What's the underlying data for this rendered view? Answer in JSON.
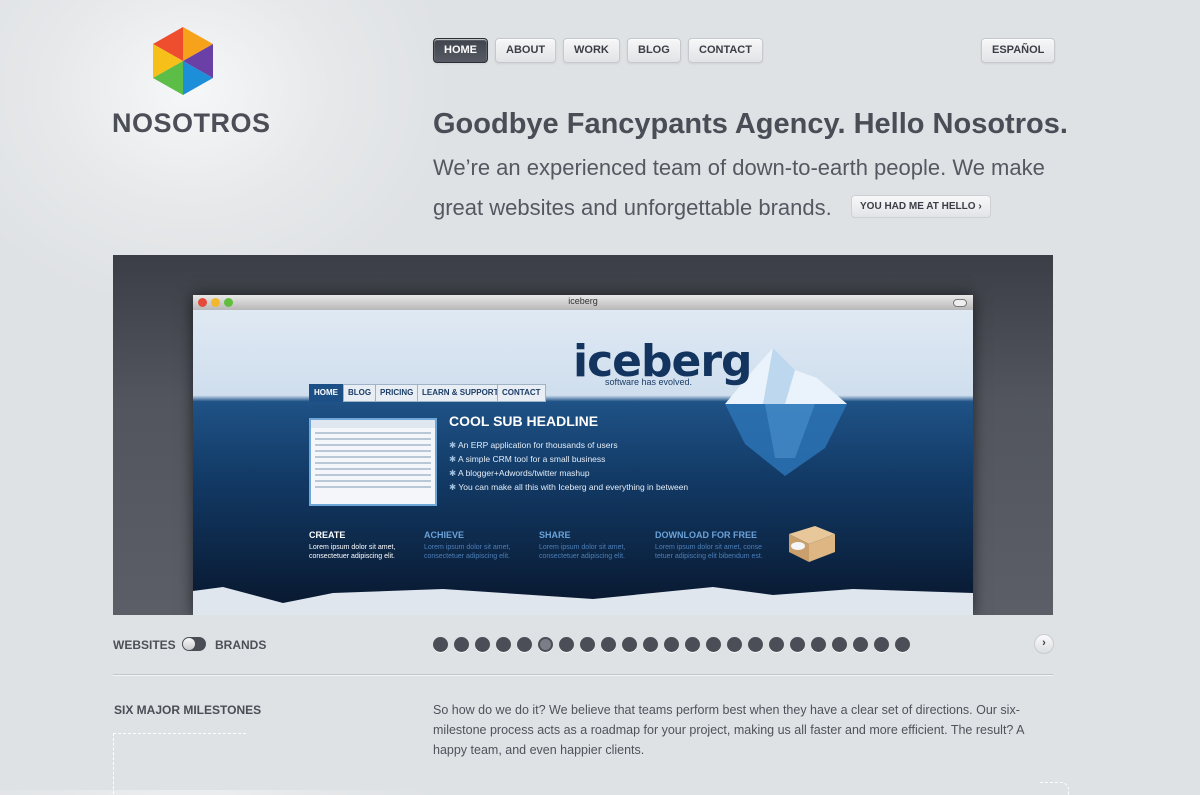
{
  "brand": {
    "name": "NOSOTROS",
    "logo_icon": "hexagon-cube-logo"
  },
  "nav": {
    "items": [
      {
        "label": "HOME",
        "active": true
      },
      {
        "label": "ABOUT"
      },
      {
        "label": "WORK"
      },
      {
        "label": "BLOG"
      },
      {
        "label": "CONTACT"
      }
    ],
    "language": "ESPAÑOL"
  },
  "hero": {
    "headline": "Goodbye Fancypants Agency. Hello Nosotros.",
    "subline": "We’re an experienced team of down-to-earth people. We make great websites and unforgettable brands.",
    "cta": "YOU HAD ME AT HELLO",
    "cta_icon": "chevron-right-icon"
  },
  "showcase": {
    "browser_title": "iceberg",
    "site": {
      "logo": "iceberg",
      "tagline": "software has evolved.",
      "tabs": [
        "HOME",
        "BLOG",
        "PRICING",
        "LEARN & SUPPORT",
        "CONTACT"
      ],
      "sub_headline": "COOL SUB HEADLINE",
      "bullets": [
        "An ERP application for thousands of users",
        "A simple CRM tool for a small business",
        "A blogger+Adwords/twitter mashup",
        "You can make all this with Iceberg and everything in between"
      ],
      "columns": [
        {
          "title": "CREATE",
          "text": "Lorem ipsum dolor sit amet, consectetuer adipiscing elit."
        },
        {
          "title": "ACHIEVE",
          "text": "Lorem ipsum dolor sit amet, consectetuer adipiscing elit."
        },
        {
          "title": "SHARE",
          "text": "Lorem ipsum dolor sit amet, consectetuer adipiscing elit."
        },
        {
          "title": "DOWNLOAD FOR FREE",
          "text": "Lorem ipsum dolor sit amet, conse tetuer adipiscing elit bibendum est."
        }
      ]
    }
  },
  "controls": {
    "left_label": "WEBSITES",
    "right_label": "BRANDS",
    "slide_count": 23,
    "active_slide": 6,
    "next_icon": "chevron-right-icon"
  },
  "milestones": {
    "title": "SIX MAJOR MILESTONES",
    "text": "So how do we do it? We believe that teams perform best when they have a clear set of directions. Our six-milestone process acts as a roadmap for your project, making us all faster and more efficient. The result? A happy team, and even happier clients."
  },
  "colors": {
    "background": "#dfe2e5",
    "text": "#4a4d55",
    "nav_active": "#4b4f58",
    "showcase_bg": "#4a4d55"
  }
}
